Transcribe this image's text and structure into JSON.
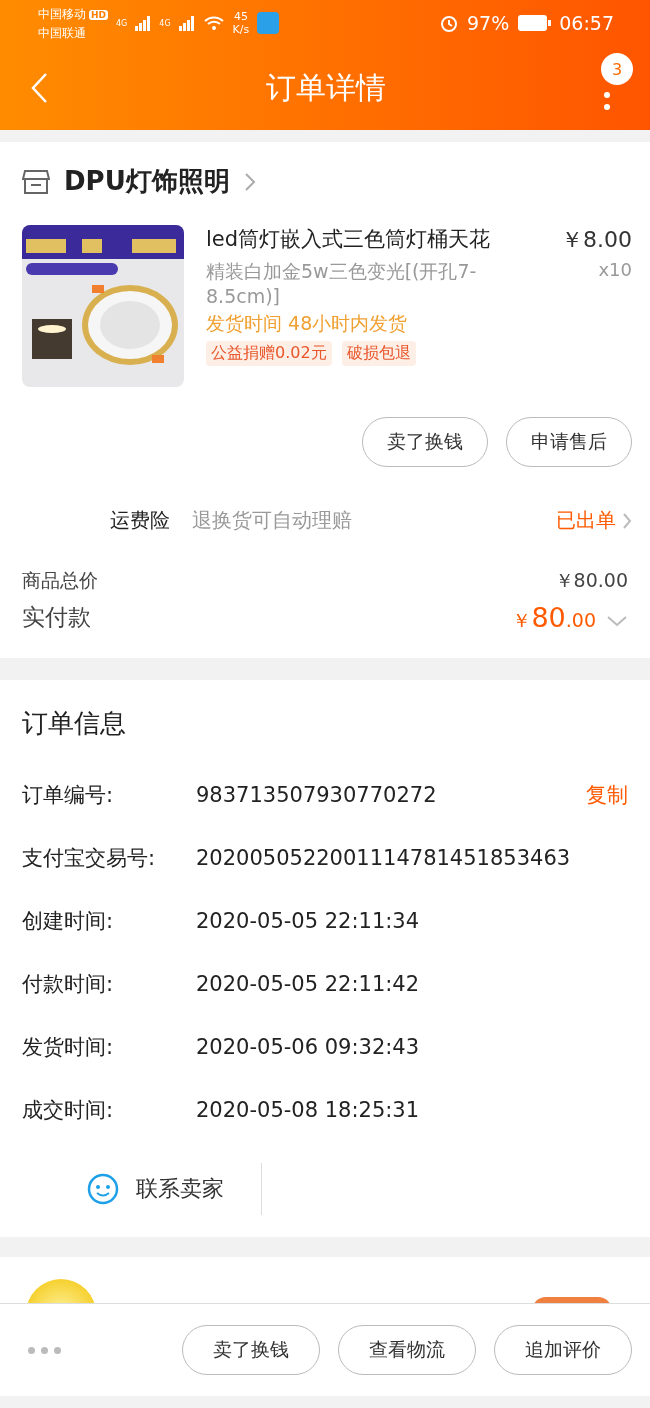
{
  "status_bar": {
    "carrier_1": "中国移动",
    "hd": "HD",
    "carrier_2": "中国联通",
    "net_1": "4G",
    "net_2": "4G",
    "speed_value": "45",
    "speed_unit": "K/s",
    "battery": "97%",
    "time": "06:57"
  },
  "nav": {
    "title": "订单详情",
    "badge": "3"
  },
  "shop": {
    "name": "DPU灯饰照明"
  },
  "product": {
    "kind": "picture",
    "title": "led筒灯嵌入式三色筒灯桶天花",
    "price": "￥8.00",
    "variant": "精装白加金5w三色变光[(开孔7-8.5cm)]",
    "quantity": "x10",
    "shipping": "发货时间 48小时内发货",
    "tags": [
      "公益捐赠0.02元",
      "破损包退"
    ]
  },
  "item_buttons": [
    "卖了换钱",
    "申请售后"
  ],
  "insurance": {
    "label": "运费险",
    "description": "退换货可自动理赔",
    "status": "已出单"
  },
  "totals": {
    "goods_label": "商品总价",
    "goods_value": "￥80.00",
    "paid_label": "实付款",
    "paid_currency": "￥",
    "paid_integer": "80",
    "paid_decimal": ".00"
  },
  "order_info": {
    "title": "订单信息",
    "rows": [
      {
        "label": "订单编号:",
        "value": "983713507930770272",
        "action": "复制"
      },
      {
        "label": "支付宝交易号:",
        "value": "2020050522001114781451853463"
      },
      {
        "label": "创建时间:",
        "value": "2020-05-05 22:11:34"
      },
      {
        "label": "付款时间:",
        "value": "2020-05-05 22:11:42"
      },
      {
        "label": "发货时间:",
        "value": "2020-05-06 09:32:43"
      },
      {
        "label": "成交时间:",
        "value": "2020-05-08 18:25:31"
      }
    ],
    "contact": "联系卖家"
  },
  "bottom_bar": {
    "buttons": [
      "卖了换钱",
      "查看物流",
      "追加评价"
    ]
  }
}
